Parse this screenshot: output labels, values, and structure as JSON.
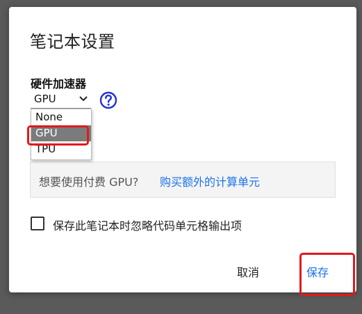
{
  "dialog": {
    "title": "笔记本设置",
    "hardware_label": "硬件加速器",
    "accelerator": {
      "selected": "GPU",
      "options": [
        "None",
        "GPU",
        "TPU"
      ]
    },
    "help_icon": "help-circle-icon",
    "promo": {
      "question": "想要使用付费 GPU?",
      "link": "购买额外的计算单元"
    },
    "omit_outputs_label": "保存此笔记本时忽略代码单元格输出项",
    "omit_outputs_checked": false,
    "cancel_label": "取消",
    "save_label": "保存"
  },
  "colors": {
    "accent": "#1a73e8",
    "highlight": "#e1191b",
    "selected_option_bg": "#7b7b7b",
    "backdrop": "#5a5a5a"
  }
}
